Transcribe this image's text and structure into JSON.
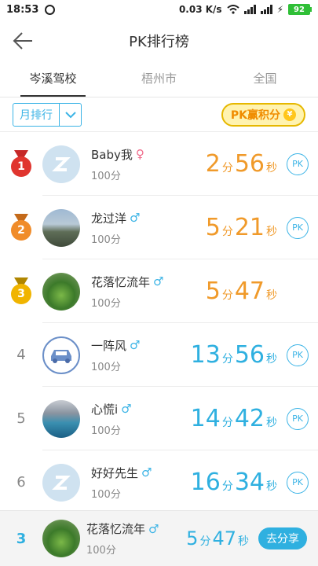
{
  "status_bar": {
    "time": "18:53",
    "net_speed": "0.03 K/s",
    "battery": "92"
  },
  "header": {
    "title": "PK排行榜"
  },
  "tabs": [
    {
      "label": "岑溪驾校",
      "active": true
    },
    {
      "label": "梧州市",
      "active": false
    },
    {
      "label": "全国",
      "active": false
    }
  ],
  "filter": {
    "period": "月排行",
    "pk_score_label": "PK赢积分"
  },
  "colors": {
    "accent_blue": "#2fb0e0",
    "accent_orange": "#f09a2a",
    "gold": "#f0b400",
    "silver_orange": "#f08c2a",
    "first_red": "#e0352f"
  },
  "leaderboard": [
    {
      "rank": "1",
      "name": "Baby我",
      "gender_icon": "female",
      "points": "100分",
      "min": "2",
      "min_unit": "分",
      "sec": "56",
      "sec_unit": "秒",
      "pk": "PK",
      "avatar": "default"
    },
    {
      "rank": "2",
      "name": "龙过洋",
      "gender_icon": "male",
      "points": "100分",
      "min": "5",
      "min_unit": "分",
      "sec": "21",
      "sec_unit": "秒",
      "pk": "PK",
      "avatar": "road-photo"
    },
    {
      "rank": "3",
      "name": "花落忆流年",
      "gender_icon": "male",
      "points": "100分",
      "min": "5",
      "min_unit": "分",
      "sec": "47",
      "sec_unit": "秒",
      "pk": "",
      "avatar": "tea-photo"
    },
    {
      "rank": "4",
      "name": "一阵风",
      "gender_icon": "male",
      "points": "100分",
      "min": "13",
      "min_unit": "分",
      "sec": "56",
      "sec_unit": "秒",
      "pk": "PK",
      "avatar": "car"
    },
    {
      "rank": "5",
      "name": "心慌i",
      "gender_icon": "male",
      "points": "100分",
      "min": "14",
      "min_unit": "分",
      "sec": "42",
      "sec_unit": "秒",
      "pk": "PK",
      "avatar": "lake-photo"
    },
    {
      "rank": "6",
      "name": "好好先生",
      "gender_icon": "male",
      "points": "100分",
      "min": "16",
      "min_unit": "分",
      "sec": "34",
      "sec_unit": "秒",
      "pk": "PK",
      "avatar": "default"
    }
  ],
  "my_rank": {
    "rank": "3",
    "name": "花落忆流年",
    "gender_icon": "male",
    "points": "100分",
    "min": "5",
    "min_unit": "分",
    "sec": "47",
    "sec_unit": "秒",
    "share_label": "去分享"
  }
}
